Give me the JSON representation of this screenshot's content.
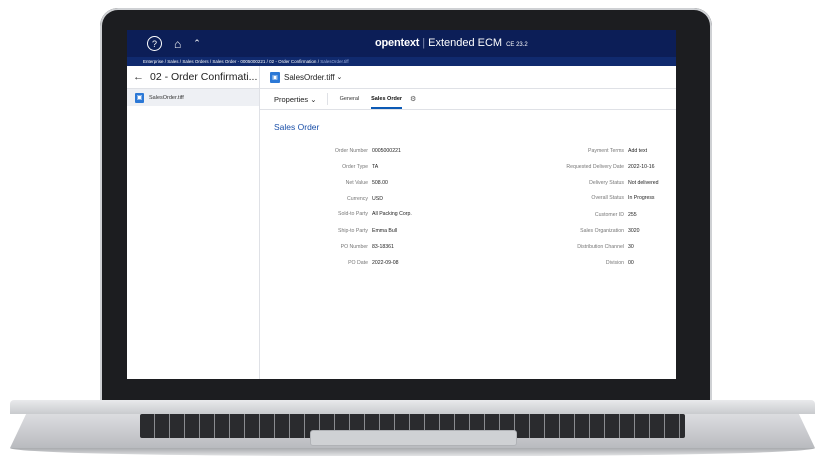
{
  "app": {
    "brand": "opentext",
    "product": "Extended ECM",
    "version": "CE 23.2"
  },
  "topbar": {
    "help_icon": "?",
    "home_icon": "home-icon",
    "up_icon": "chevron-up-icon"
  },
  "breadcrumbs": [
    "Enterprise",
    "Sales",
    "Sales Orders",
    "Sales Order - 0005000221",
    "02 - Order Confirmation",
    "SalesOrder.tiff"
  ],
  "breadcrumb_sep": " / ",
  "left": {
    "title": "02 - Order Confirmati...",
    "items": [
      {
        "label": "SalesOrder.tiff"
      }
    ]
  },
  "doc": {
    "name": "SalesOrder.tiff",
    "properties_label": "Properties",
    "tabs": [
      "General",
      "Sales Order"
    ],
    "active_tab": "Sales Order"
  },
  "section_title": "Sales Order",
  "fields_left": [
    {
      "label": "Order Number",
      "value": "0005000221"
    },
    {
      "label": "Order Type",
      "value": "TA"
    },
    {
      "label": "Net Value",
      "value": "508.00"
    },
    {
      "label": "Currency",
      "value": "USD"
    },
    {
      "label": "Sold-to Party",
      "value": "All Packing Corp."
    },
    {
      "label": "Ship-to Party",
      "value": "Emma Bull"
    },
    {
      "label": "PO Number",
      "value": "83-18361"
    },
    {
      "label": "PO Date",
      "value": "2022-09-08"
    }
  ],
  "fields_right": [
    {
      "label": "Payment Terms",
      "value": "Add text"
    },
    {
      "label": "Requested Delivery Date",
      "value": "2022-10-16"
    },
    {
      "label": "Delivery Status",
      "value": "Not delivered"
    },
    {
      "label": "Overall Status",
      "value": "In Progress"
    },
    {
      "label": "Customer ID",
      "value": "255"
    },
    {
      "label": "Sales Organization",
      "value": "3020"
    },
    {
      "label": "Distribution Channel",
      "value": "30"
    },
    {
      "label": "Division",
      "value": "00"
    }
  ],
  "colors": {
    "header": "#0c1e57",
    "accent": "#1a4fa8"
  }
}
